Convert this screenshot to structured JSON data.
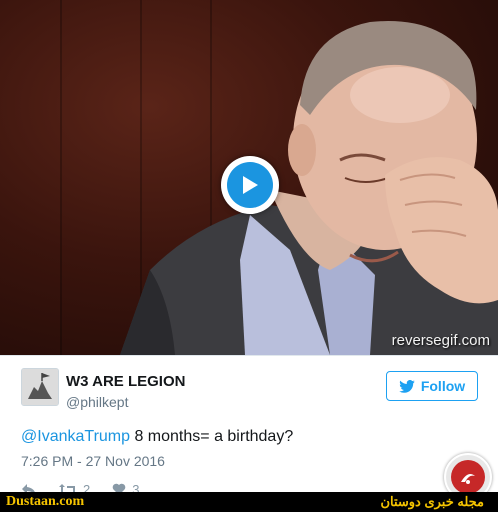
{
  "media": {
    "watermark": "reversegif.com"
  },
  "tweet": {
    "display_name": "W3 ARE LEGION",
    "handle": "@philkept",
    "follow_label": "Follow",
    "mention": "@IvankaTrump",
    "text": " 8 months= a birthday?",
    "timestamp": "7:26 PM - 27 Nov 2016",
    "retweet_count": "2",
    "like_count": "3"
  },
  "footer": {
    "site": "Dustaan.com",
    "tagline": "مجله خبری دوستان"
  },
  "colors": {
    "accent": "#1da1f2",
    "link": "#1b95e0",
    "footer_text": "#f5c400"
  }
}
